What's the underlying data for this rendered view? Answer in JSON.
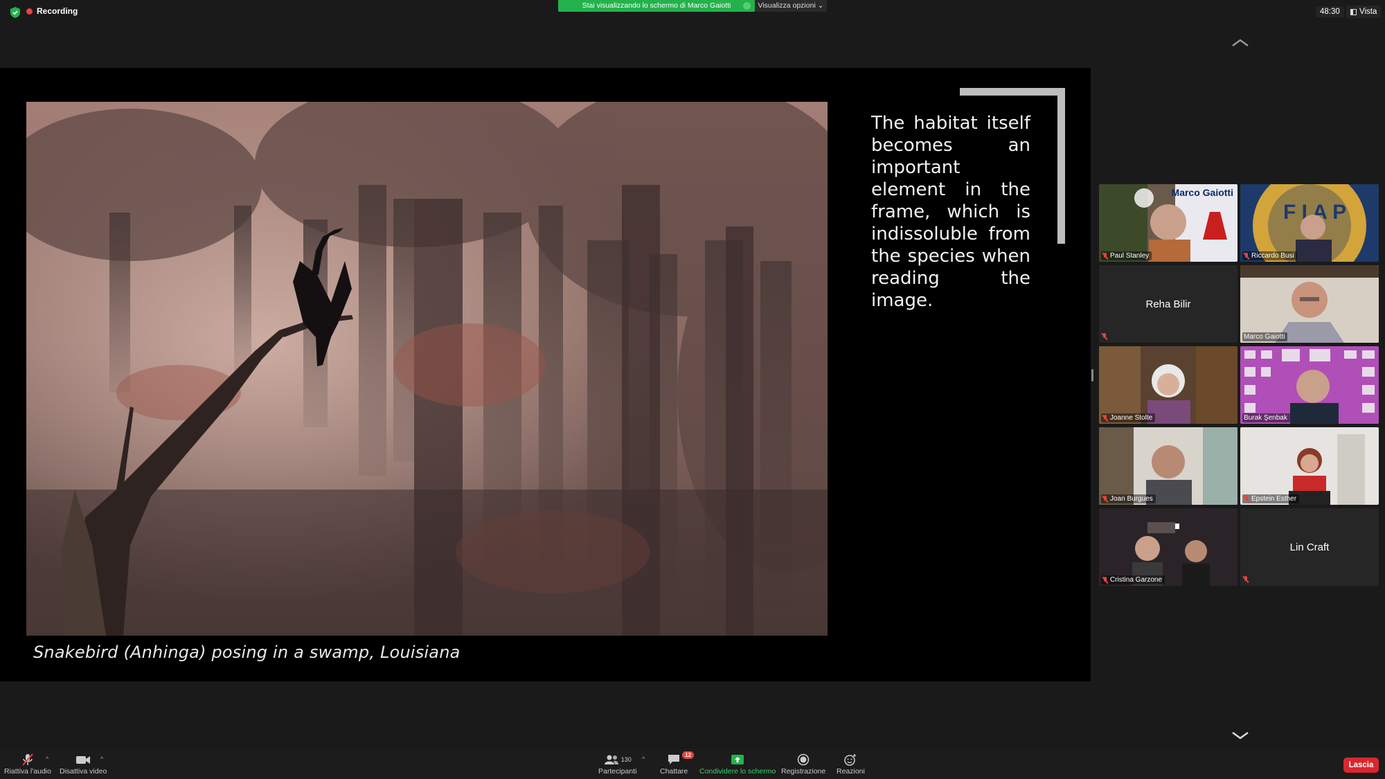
{
  "top_bar": {
    "recording_label": "Recording",
    "share_banner": "Stai visualizzando lo schermo di Marco Gaiotti",
    "view_options": "Visualizza opzioni ⌄",
    "clock": "48:30",
    "view_label": "Vista"
  },
  "slide": {
    "caption": "Snakebird (Anhinga) posing in a swamp, Louisiana",
    "text": "The habitat itself becomes an important element in the frame, which is indissoluble from the species when reading the image."
  },
  "gallery": {
    "participants": [
      {
        "name": "Paul Stanley",
        "video": true,
        "muted": true,
        "overlay_title": "Marco Gaiotti"
      },
      {
        "name": "Riccardo Busi",
        "video": true,
        "muted": true
      },
      {
        "name": "Reha Bilir",
        "video": false,
        "muted": true
      },
      {
        "name": "Marco Gaiotti",
        "video": true,
        "muted": false,
        "active_speaker": true
      },
      {
        "name": "Joanne Stolte",
        "video": true,
        "muted": true
      },
      {
        "name": "Burak Şenbak",
        "video": true,
        "muted": false
      },
      {
        "name": "Joan Burgues",
        "video": true,
        "muted": true
      },
      {
        "name": "Epstein Esther",
        "video": true,
        "muted": true
      },
      {
        "name": "Cristina Garzone",
        "video": true,
        "muted": true
      },
      {
        "name": "Lin Craft",
        "video": false,
        "muted": true
      }
    ]
  },
  "toolbar": {
    "audio_label": "Riattiva l'audio",
    "video_label": "Disattiva video",
    "participants_label": "Partecipanti",
    "participants_count": "130",
    "chat_label": "Chattare",
    "chat_badge": "12",
    "share_label": "Condividere lo schermo",
    "record_label": "Registrazione",
    "reactions_label": "Reazioni",
    "leave_label": "Lascia"
  },
  "colors": {
    "share_green": "#23b24b",
    "leave_red": "#d9272e",
    "active_speaker_border": "#c7e86b",
    "recording_red": "#e8423f"
  }
}
